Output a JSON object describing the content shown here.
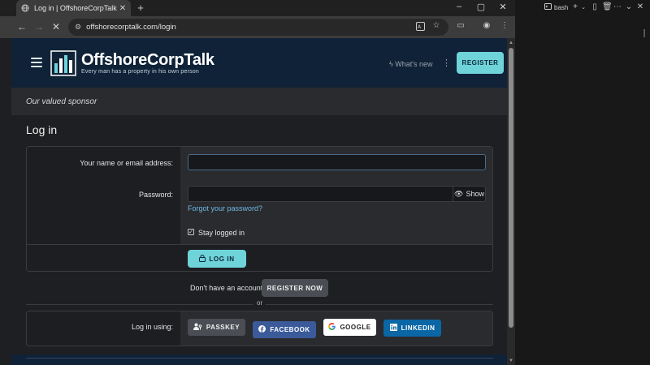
{
  "browser": {
    "tab_title": "Log in | OffshoreCorpTalk",
    "tab_favicon": "globe-icon",
    "url": "offshorecorptalk.com/login",
    "new_tab_symbol": "+"
  },
  "site": {
    "brand": "OffshoreCorpTalk",
    "tagline": "Every man has a property in his own person",
    "whats_new": "What's new",
    "register_label": "REGISTER",
    "sponsor_text": "Our valued sponsor"
  },
  "login": {
    "title": "Log in",
    "name_label": "Your name or email address:",
    "name_value": "",
    "password_label": "Password:",
    "password_value": "",
    "show_label": "Show",
    "forgot_label": "Forgot your password?",
    "stay_logged_label": "Stay logged in",
    "stay_logged_checked": true,
    "login_button": "LOG IN"
  },
  "signup": {
    "prompt": "Don't have an account?",
    "register_now": "REGISTER NOW",
    "or": "or"
  },
  "social": {
    "label": "Log in using:",
    "buttons": [
      {
        "label": "PASSKEY",
        "icon": "passkey-icon",
        "color": "#4a4d53"
      },
      {
        "label": "FACEBOOK",
        "icon": "facebook-icon",
        "color": "#3b5a9a"
      },
      {
        "label": "GOOGLE",
        "icon": "google-icon",
        "color": "#ffffff"
      },
      {
        "label": "LINKEDIN",
        "icon": "linkedin-icon",
        "color": "#0a66a5"
      }
    ]
  },
  "side_panel": {
    "terminal_label": "bash"
  },
  "colors": {
    "accent": "#6fd3da",
    "header_bg": "#0f2237",
    "link": "#6fb7e0"
  }
}
